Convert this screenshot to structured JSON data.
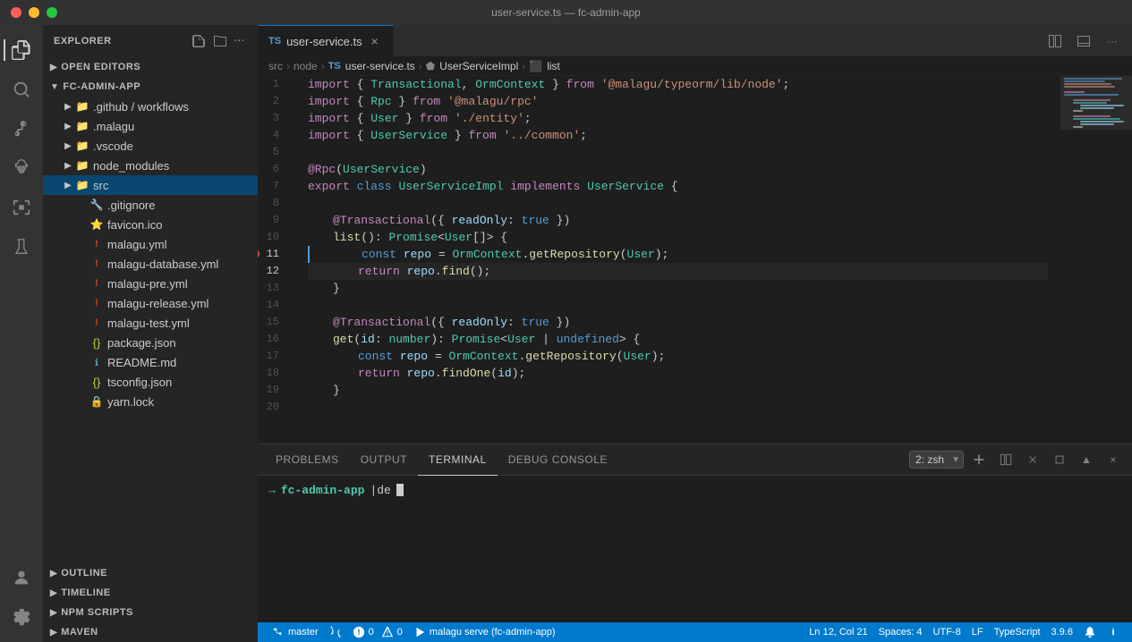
{
  "titlebar": {
    "title": "user-service.ts — fc-admin-app"
  },
  "activity": {
    "icons": [
      "explorer",
      "search",
      "source-control",
      "debug",
      "extensions",
      "testing"
    ]
  },
  "sidebar": {
    "header": "Explorer",
    "open_editors_label": "Open Editors",
    "project_label": "FC-ADMIN-APP",
    "folders": [
      {
        "name": ".github / workflows",
        "indent": 1
      },
      {
        "name": ".malagu",
        "indent": 1
      },
      {
        "name": ".vscode",
        "indent": 1
      },
      {
        "name": "node_modules",
        "indent": 1
      },
      {
        "name": "src",
        "indent": 1,
        "selected": true
      },
      {
        "name": ".gitignore",
        "indent": 1,
        "icon": "file"
      },
      {
        "name": "favicon.ico",
        "indent": 1,
        "icon": "star"
      },
      {
        "name": "malagu.yml",
        "indent": 1,
        "icon": "exclamation"
      },
      {
        "name": "malagu-database.yml",
        "indent": 1,
        "icon": "exclamation"
      },
      {
        "name": "malagu-pre.yml",
        "indent": 1,
        "icon": "exclamation"
      },
      {
        "name": "malagu-release.yml",
        "indent": 1,
        "icon": "exclamation"
      },
      {
        "name": "malagu-test.yml",
        "indent": 1,
        "icon": "exclamation"
      },
      {
        "name": "package.json",
        "indent": 1,
        "icon": "braces"
      },
      {
        "name": "README.md",
        "indent": 1,
        "icon": "info"
      },
      {
        "name": "tsconfig.json",
        "indent": 1,
        "icon": "braces"
      },
      {
        "name": "yarn.lock",
        "indent": 1,
        "icon": "lock"
      }
    ],
    "outline_label": "Outline",
    "timeline_label": "Timeline",
    "npm_scripts_label": "NPM Scripts",
    "maven_label": "Maven"
  },
  "editor": {
    "tab_label": "user-service.ts",
    "tab_lang": "TS",
    "breadcrumb": [
      "src",
      "node",
      "TS user-service.ts",
      "UserServiceImpl",
      "list"
    ],
    "lines": [
      {
        "num": 1,
        "content": "import { Transactional, OrmContext } from '@malagu/typeorm/lib/node';"
      },
      {
        "num": 2,
        "content": "import { Rpc } from '@malagu/rpc'"
      },
      {
        "num": 3,
        "content": "import { User } from './entity';"
      },
      {
        "num": 4,
        "content": "import { UserService } from '../common';"
      },
      {
        "num": 5,
        "content": ""
      },
      {
        "num": 6,
        "content": "@Rpc(UserService)"
      },
      {
        "num": 7,
        "content": "export class UserServiceImpl implements UserService {"
      },
      {
        "num": 8,
        "content": ""
      },
      {
        "num": 9,
        "content": "    @Transactional({ readOnly: true })"
      },
      {
        "num": 10,
        "content": "    list(): Promise<User[]> {"
      },
      {
        "num": 11,
        "content": "        const repo = OrmContext.getRepository(User);",
        "modified": true
      },
      {
        "num": 12,
        "content": "        return repo.find();"
      },
      {
        "num": 13,
        "content": "    }"
      },
      {
        "num": 14,
        "content": ""
      },
      {
        "num": 15,
        "content": "    @Transactional({ readOnly: true })"
      },
      {
        "num": 16,
        "content": "    get(id: number): Promise<User | undefined> {"
      },
      {
        "num": 17,
        "content": "        const repo = OrmContext.getRepository(User);"
      },
      {
        "num": 18,
        "content": "        return repo.findOne(id);"
      },
      {
        "num": 19,
        "content": "    }"
      },
      {
        "num": 20,
        "content": ""
      }
    ]
  },
  "panel": {
    "tabs": [
      "PROBLEMS",
      "OUTPUT",
      "TERMINAL",
      "DEBUG CONSOLE"
    ],
    "active_tab": "TERMINAL",
    "terminal_label": "2: zsh",
    "terminal_prompt": "→",
    "terminal_path": "fc-admin-app",
    "terminal_cmd": "|de"
  },
  "statusbar": {
    "branch": "master",
    "sync": "",
    "errors": "0",
    "warnings": "0",
    "run": "malagu serve (fc-admin-app)",
    "line_col": "Ln 12, Col 21",
    "spaces": "Spaces: 4",
    "encoding": "UTF-8",
    "eol": "LF",
    "language": "TypeScript",
    "version": "3.9.6",
    "bell": "",
    "notifications": ""
  }
}
